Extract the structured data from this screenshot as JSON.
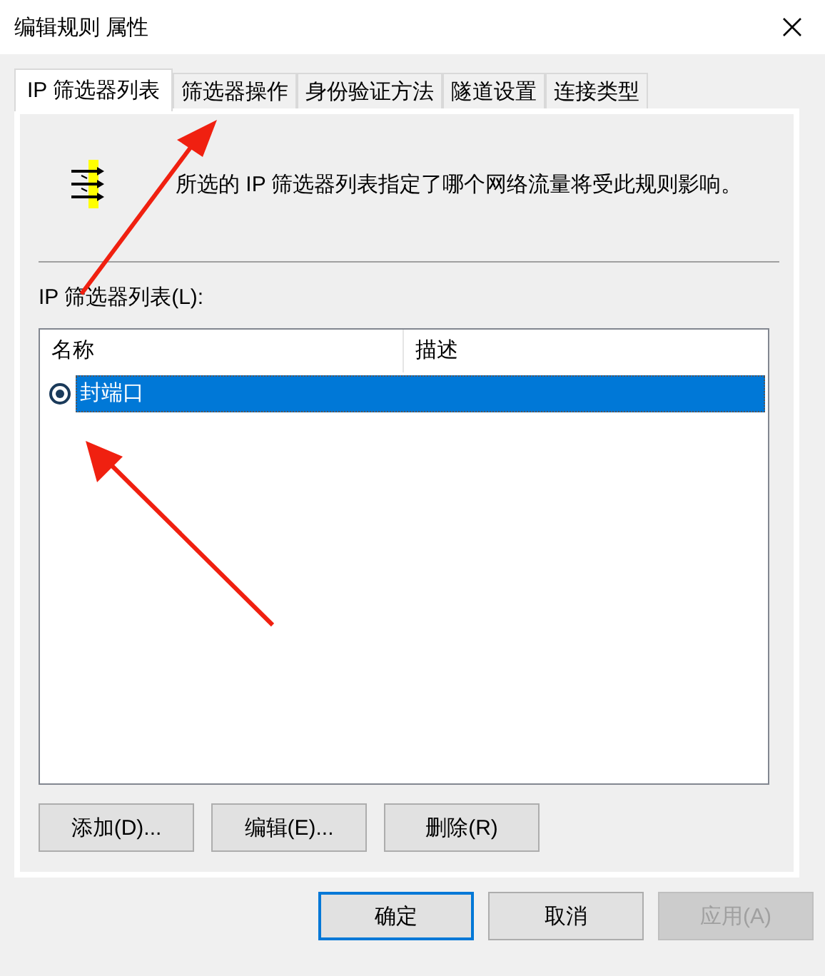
{
  "window": {
    "title": "编辑规则 属性"
  },
  "tabs": [
    {
      "label": "IP 筛选器列表",
      "selected": true
    },
    {
      "label": "筛选器操作",
      "selected": false
    },
    {
      "label": "身份验证方法",
      "selected": false
    },
    {
      "label": "隧道设置",
      "selected": false
    },
    {
      "label": "连接类型",
      "selected": false
    }
  ],
  "description": "所选的 IP 筛选器列表指定了哪个网络流量将受此规则影响。",
  "list": {
    "label": "IP 筛选器列表(L):",
    "columns": [
      "名称",
      "描述"
    ],
    "rows": [
      {
        "name": "封端口",
        "checked": true,
        "selected": true
      }
    ]
  },
  "list_buttons": [
    "添加(D)...",
    "编辑(E)...",
    "删除(R)"
  ],
  "dialog_buttons": [
    {
      "label": "确定",
      "default": true,
      "disabled": false
    },
    {
      "label": "取消",
      "default": false,
      "disabled": false
    },
    {
      "label": "应用(A)",
      "default": false,
      "disabled": true
    }
  ]
}
